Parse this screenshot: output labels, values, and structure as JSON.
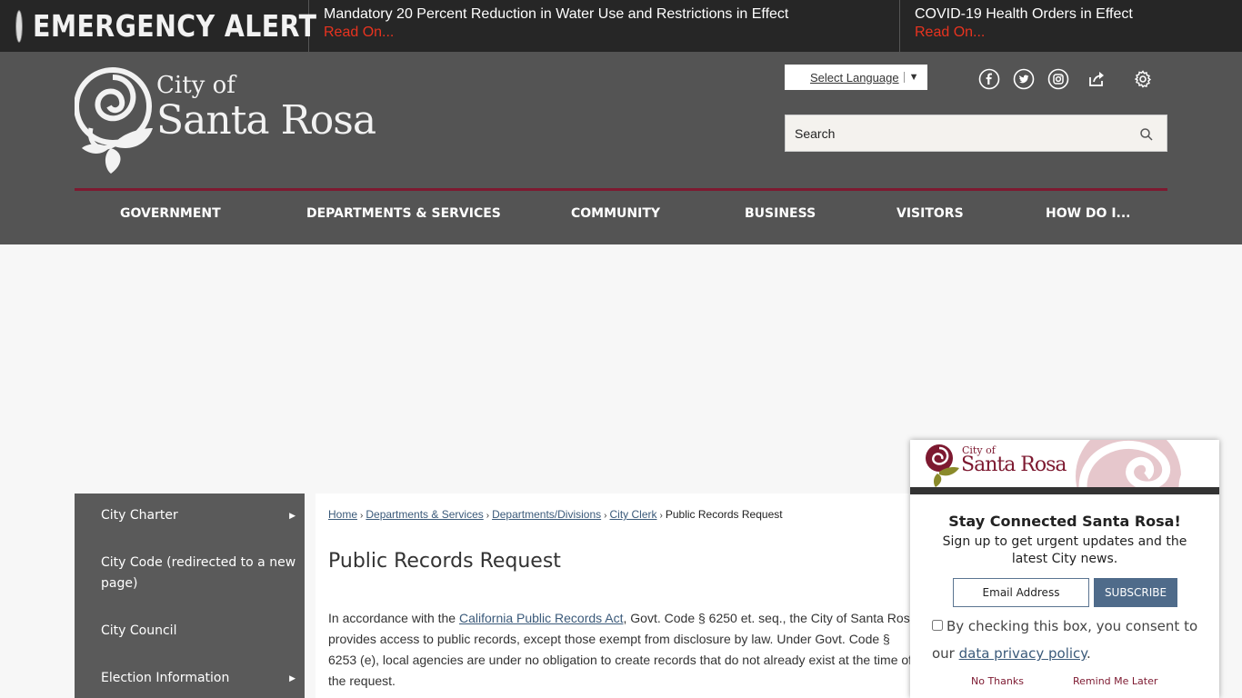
{
  "alert": {
    "label": "EMERGENCY ALERT",
    "items": [
      {
        "headline": "Mandatory 20 Percent Reduction in Water Use and Restrictions in Effect",
        "link": "Read On..."
      },
      {
        "headline": "COVID-19 Health Orders in Effect",
        "link": "Read On..."
      }
    ]
  },
  "logo": {
    "line1": "City of",
    "line2": "Santa Rosa"
  },
  "language": {
    "label": "Select Language",
    "arrow": "▼"
  },
  "social": [
    "facebook-icon",
    "twitter-icon",
    "instagram-icon",
    "share-icon",
    "gear-icon"
  ],
  "search": {
    "placeholder": "Search"
  },
  "nav": [
    "GOVERNMENT",
    "DEPARTMENTS & SERVICES",
    "COMMUNITY",
    "BUSINESS",
    "VISITORS",
    "HOW DO I..."
  ],
  "sidenav": [
    {
      "label": "City Charter",
      "arrow": "▶"
    },
    {
      "label": "City Code (redirected to a new page)"
    },
    {
      "label": "City Council"
    },
    {
      "label": "Election Information",
      "arrow": "▶"
    }
  ],
  "breadcrumbs": [
    "Home",
    "Departments & Services",
    "Departments/Divisions",
    "City Clerk"
  ],
  "breadcrumb_current": "Public Records Request",
  "breadcrumb_sep": "›",
  "page": {
    "title": "Public Records Request",
    "para_before": "In accordance with the ",
    "para_link": "California Public Records Act",
    "para_after": ", Govt. Code § 6250 et. seq., the City of Santa Rosa provides access to public records, except those exempt from disclosure by law. Under Govt. Code § 6253 (e), local agencies are under no obligation to create records that do not already exist at the time of the request."
  },
  "popup": {
    "logo_line1": "City of",
    "logo_line2": "Santa Rosa",
    "title": "Stay Connected Santa Rosa!",
    "subtitle": "Sign up to get urgent updates and the latest City news.",
    "email_placeholder": "Email Address",
    "subscribe_label": "SUBSCRIBE",
    "consent_before": "By checking this box, you consent to our ",
    "consent_link": "data privacy policy",
    "consent_after": ".",
    "no_thanks": "No Thanks",
    "remind_later": "Remind Me Later"
  },
  "colors": {
    "alert_red": "#e8331f",
    "header_bg": "#545454",
    "nav_rule": "#7d1930",
    "link_blue": "#3b5a7a"
  }
}
